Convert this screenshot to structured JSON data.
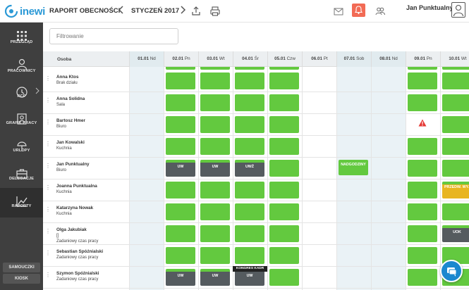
{
  "app": {
    "logo_text": "inewi",
    "report_title": "RAPORT OBECNOŚCI",
    "month": "STYCZEŃ 2017",
    "user_name": "Jan Punktualny"
  },
  "colors": {
    "accent": "#2b99d6",
    "work_green": "#63c93f",
    "dark_absence": "#555b5f",
    "overtime_orange": "#e8b520",
    "bell_red": "#f26b55",
    "sidebar": "#3f3f3f"
  },
  "icons": {
    "prev": "chevron-left-icon",
    "next": "chevron-right-icon",
    "export": "export-icon",
    "print": "printer-icon",
    "mail": "envelope-icon",
    "bell": "bell-icon",
    "group": "users-icon",
    "avatar": "user-avatar-icon"
  },
  "sidebar": {
    "items": [
      {
        "label": "PRZEGLĄD",
        "icon": "grid-dots-icon"
      },
      {
        "label": "PRACOWNICY",
        "icon": "users-icon"
      },
      {
        "label": "RCP",
        "icon": "clock-icon"
      },
      {
        "label": "GRAFIK PRACY",
        "icon": "schedule-icon"
      },
      {
        "label": "URLOPY",
        "icon": "vacation-icon"
      },
      {
        "label": "DELEGACJE",
        "icon": "briefcase-icon"
      },
      {
        "label": "RAPORTY",
        "icon": "chart-icon"
      }
    ],
    "bottom_buttons": [
      "SAMOUCZKI",
      "KIOSK"
    ]
  },
  "filter": {
    "placeholder": "Filtrowanie"
  },
  "grid": {
    "person_header": "Osoba",
    "days": [
      {
        "date": "01.01",
        "dow": "Nd"
      },
      {
        "date": "02.01",
        "dow": "Pn"
      },
      {
        "date": "03.01",
        "dow": "Wt"
      },
      {
        "date": "04.01",
        "dow": "Śr"
      },
      {
        "date": "05.01",
        "dow": "Czw"
      },
      {
        "date": "06.01",
        "dow": "Pt"
      },
      {
        "date": "07.01",
        "dow": "Sob"
      },
      {
        "date": "08.01",
        "dow": "Nd"
      },
      {
        "date": "09.01",
        "dow": "Pn"
      },
      {
        "date": "10.01",
        "dow": "Wt"
      }
    ],
    "rows": [
      {
        "name": "Anna Ktos",
        "sub": "Brak działu",
        "cells": [
          "",
          "g",
          "g",
          "g",
          "g",
          "",
          "",
          "",
          "g",
          "g"
        ]
      },
      {
        "name": "Anna Solidna",
        "sub": "Sala",
        "cells": [
          "",
          "g",
          "g",
          "g",
          "g",
          "",
          "",
          "",
          "g",
          "g"
        ]
      },
      {
        "name": "Bartosz Hmer",
        "sub": "Biuro",
        "cells": [
          "",
          "g",
          "g",
          "g",
          "g",
          "",
          "",
          "",
          "warn",
          "g"
        ]
      },
      {
        "name": "Jan Kowalski",
        "sub": "Kuchnia",
        "cells": [
          "",
          "g",
          "g",
          "g",
          "g",
          "",
          "",
          "",
          "g",
          "g"
        ]
      },
      {
        "name": "Jan Punktualny",
        "sub": "Biuro",
        "cells": [
          "",
          "d:UW",
          "d:UW",
          "d:UWŻ",
          "g",
          "",
          "gt:NADGODZINY",
          "",
          "g",
          "g"
        ]
      },
      {
        "name": "Joanna Punktualna",
        "sub": "Kuchnia",
        "cells": [
          "",
          "g",
          "g",
          "g",
          "g",
          "",
          "",
          "",
          "g",
          "o:PRZEDW. WYJ"
        ]
      },
      {
        "name": "Katarzyna Nowak",
        "sub": "Kuchnia",
        "cells": [
          "",
          "g",
          "g",
          "g",
          "g",
          "",
          "",
          "",
          "g",
          "g"
        ]
      },
      {
        "name": "Olga Jakubiak",
        "sub": "[]\nZadaniowy czas pracy",
        "cells": [
          "",
          "g",
          "g",
          "g",
          "g",
          "",
          "",
          "",
          "g",
          "d:UOK"
        ]
      },
      {
        "name": "Sebastian Spóźnialski",
        "sub": "Zadaniowy czas pracy",
        "cells": [
          "",
          "g",
          "g",
          "g",
          "g",
          "",
          "",
          "",
          "g",
          "g"
        ]
      },
      {
        "name": "Szymon Spóźnialski",
        "sub": "Zadaniowy czas pracy",
        "cells": [
          "",
          "d:UW",
          "d:UW",
          "d:UW",
          "g",
          "",
          "",
          "",
          "g",
          "g"
        ],
        "badge": {
          "col": 3,
          "text": "KONGRES KADR"
        }
      }
    ]
  }
}
